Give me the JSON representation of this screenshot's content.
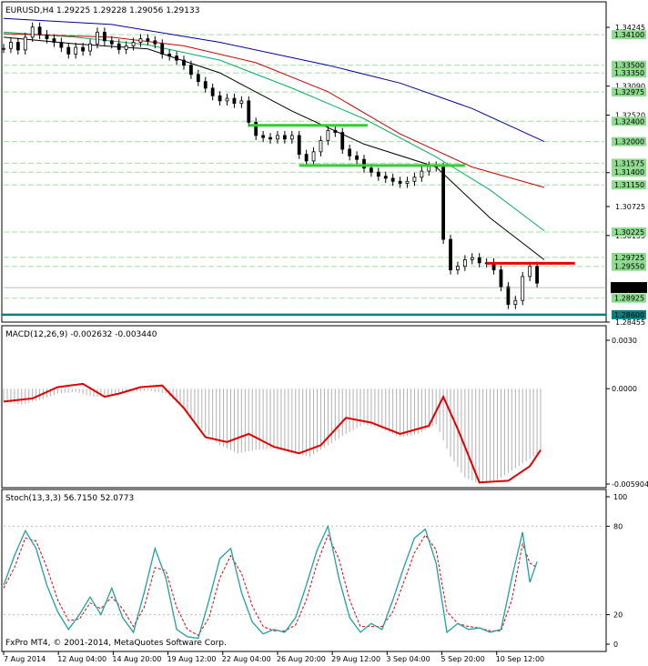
{
  "chart_data": [
    {
      "id": "price",
      "type": "candlestick",
      "title": "EURUSD,H4  1.29225 1.29228 1.29056 1.29133",
      "symbol": "EURUSD,H4",
      "ohlc_last": [
        1.29225,
        1.29228,
        1.29056,
        1.29133
      ],
      "ylim": [
        1.28455,
        1.34424
      ],
      "y_tick_labels": [
        "1.34245",
        "1.33090",
        "1.32520",
        "1.31390",
        "1.30725",
        "1.30155",
        "1.28455"
      ],
      "current_price": "1.29133",
      "level_labels": [
        "1.34100",
        "1.33500",
        "1.33350",
        "1.32975",
        "1.32400",
        "1.32000",
        "1.31575",
        "1.31400",
        "1.31150",
        "1.30225",
        "1.29725",
        "1.29550",
        "1.28925",
        "1.28600"
      ],
      "horizontal_levels": [
        1.341,
        1.335,
        1.3335,
        1.32975,
        1.324,
        1.32,
        1.31575,
        1.314,
        1.3115,
        1.30225,
        1.29725,
        1.2955,
        1.28925
      ],
      "support_level": 1.286,
      "green_lines": [
        {
          "x_from": 68,
          "x_to": 101,
          "y": 1.3232
        },
        {
          "x_from": 82,
          "x_to": 128,
          "y": 1.3153
        }
      ],
      "red_line": {
        "x_from": 134,
        "x_to": 157,
        "y": 1.2961
      },
      "bar_count": 150,
      "candles": [
        {
          "x": 0,
          "c": 1.3383
        },
        {
          "x": 2,
          "c": 1.3395
        },
        {
          "x": 4,
          "c": 1.338
        },
        {
          "x": 6,
          "c": 1.3405
        },
        {
          "x": 8,
          "c": 1.3425
        },
        {
          "x": 10,
          "c": 1.341
        },
        {
          "x": 12,
          "c": 1.3402
        },
        {
          "x": 14,
          "c": 1.3395
        },
        {
          "x": 16,
          "c": 1.3385
        },
        {
          "x": 18,
          "c": 1.3372
        },
        {
          "x": 20,
          "c": 1.3385
        },
        {
          "x": 22,
          "c": 1.3378
        },
        {
          "x": 24,
          "c": 1.3392
        },
        {
          "x": 26,
          "c": 1.3415
        },
        {
          "x": 28,
          "c": 1.3398
        },
        {
          "x": 30,
          "c": 1.3392
        },
        {
          "x": 32,
          "c": 1.3381
        },
        {
          "x": 34,
          "c": 1.3388
        },
        {
          "x": 36,
          "c": 1.3395
        },
        {
          "x": 38,
          "c": 1.3402
        },
        {
          "x": 40,
          "c": 1.3398
        },
        {
          "x": 42,
          "c": 1.3392
        },
        {
          "x": 44,
          "c": 1.3372
        },
        {
          "x": 46,
          "c": 1.3368
        },
        {
          "x": 48,
          "c": 1.336
        },
        {
          "x": 50,
          "c": 1.335
        },
        {
          "x": 52,
          "c": 1.3332
        },
        {
          "x": 54,
          "c": 1.3318
        },
        {
          "x": 56,
          "c": 1.3305
        },
        {
          "x": 58,
          "c": 1.329
        },
        {
          "x": 60,
          "c": 1.328
        },
        {
          "x": 62,
          "c": 1.3285
        },
        {
          "x": 64,
          "c": 1.3275
        },
        {
          "x": 66,
          "c": 1.328
        },
        {
          "x": 68,
          "c": 1.3238
        },
        {
          "x": 70,
          "c": 1.3212
        },
        {
          "x": 72,
          "c": 1.3208
        },
        {
          "x": 74,
          "c": 1.3205
        },
        {
          "x": 76,
          "c": 1.3212
        },
        {
          "x": 78,
          "c": 1.3205
        },
        {
          "x": 80,
          "c": 1.3212
        },
        {
          "x": 82,
          "c": 1.3175
        },
        {
          "x": 84,
          "c": 1.3162
        },
        {
          "x": 86,
          "c": 1.318
        },
        {
          "x": 88,
          "c": 1.3202
        },
        {
          "x": 90,
          "c": 1.3222
        },
        {
          "x": 92,
          "c": 1.3218
        },
        {
          "x": 94,
          "c": 1.3185
        },
        {
          "x": 96,
          "c": 1.3172
        },
        {
          "x": 98,
          "c": 1.3165
        },
        {
          "x": 100,
          "c": 1.3148
        },
        {
          "x": 102,
          "c": 1.314
        },
        {
          "x": 104,
          "c": 1.3132
        },
        {
          "x": 106,
          "c": 1.3128
        },
        {
          "x": 108,
          "c": 1.3122
        },
        {
          "x": 110,
          "c": 1.3118
        },
        {
          "x": 112,
          "c": 1.3122
        },
        {
          "x": 114,
          "c": 1.313
        },
        {
          "x": 116,
          "c": 1.3142
        },
        {
          "x": 118,
          "c": 1.3152
        },
        {
          "x": 120,
          "c": 1.315
        },
        {
          "x": 122,
          "c": 1.3008
        },
        {
          "x": 124,
          "c": 1.2948
        },
        {
          "x": 126,
          "c": 1.2955
        },
        {
          "x": 128,
          "c": 1.2968
        },
        {
          "x": 130,
          "c": 1.2972
        },
        {
          "x": 132,
          "c": 1.2962
        },
        {
          "x": 134,
          "c": 1.2962
        },
        {
          "x": 136,
          "c": 1.2948
        },
        {
          "x": 138,
          "c": 1.2915
        },
        {
          "x": 140,
          "c": 1.288
        },
        {
          "x": 142,
          "c": 1.2888
        },
        {
          "x": 144,
          "c": 1.2935
        },
        {
          "x": 146,
          "c": 1.2955
        },
        {
          "x": 148,
          "c": 1.2922
        }
      ],
      "moving_averages": [
        {
          "color": "#000000",
          "points": [
            [
              0,
              1.3405
            ],
            [
              20,
              1.3392
            ],
            [
              40,
              1.3382
            ],
            [
              60,
              1.3335
            ],
            [
              80,
              1.326
            ],
            [
              100,
              1.3195
            ],
            [
              120,
              1.315
            ],
            [
              135,
              1.305
            ],
            [
              150,
              1.2968
            ]
          ]
        },
        {
          "color": "#00b060",
          "points": [
            [
              0,
              1.3415
            ],
            [
              20,
              1.3405
            ],
            [
              40,
              1.339
            ],
            [
              60,
              1.336
            ],
            [
              80,
              1.3305
            ],
            [
              100,
              1.3245
            ],
            [
              120,
              1.317
            ],
            [
              135,
              1.3105
            ],
            [
              150,
              1.3025
            ]
          ]
        },
        {
          "color": "#cc0000",
          "points": [
            [
              0,
              1.3412
            ],
            [
              30,
              1.3405
            ],
            [
              50,
              1.3388
            ],
            [
              70,
              1.3355
            ],
            [
              90,
              1.3298
            ],
            [
              110,
              1.3215
            ],
            [
              130,
              1.315
            ],
            [
              150,
              1.311
            ]
          ]
        },
        {
          "color": "#000099",
          "points": [
            [
              0,
              1.3442
            ],
            [
              30,
              1.343
            ],
            [
              60,
              1.3395
            ],
            [
              90,
              1.335
            ],
            [
              110,
              1.3315
            ],
            [
              130,
              1.3265
            ],
            [
              150,
              1.32
            ]
          ]
        }
      ]
    },
    {
      "id": "macd",
      "type": "bar+line",
      "title": "MACD(12,26,9) -0.002632 -0.003440",
      "ylim": [
        -0.00590418,
        0.003
      ],
      "y_tick_labels": [
        "0.0030",
        "0.0000",
        "-0.005904"
      ],
      "histogram": [
        {
          "x": 0,
          "v": -0.0008
        },
        {
          "x": 5,
          "v": -0.001
        },
        {
          "x": 10,
          "v": -0.0007
        },
        {
          "x": 15,
          "v": -0.0003
        },
        {
          "x": 20,
          "v": -0.0002
        },
        {
          "x": 25,
          "v": -0.0005
        },
        {
          "x": 30,
          "v": -0.0004
        },
        {
          "x": 35,
          "v": -0.0002
        },
        {
          "x": 40,
          "v": -0.0001
        },
        {
          "x": 45,
          "v": -0.0003
        },
        {
          "x": 50,
          "v": -0.0012
        },
        {
          "x": 55,
          "v": -0.0025
        },
        {
          "x": 60,
          "v": -0.0035
        },
        {
          "x": 65,
          "v": -0.004
        },
        {
          "x": 70,
          "v": -0.0038
        },
        {
          "x": 75,
          "v": -0.0037
        },
        {
          "x": 80,
          "v": -0.004
        },
        {
          "x": 85,
          "v": -0.0042
        },
        {
          "x": 90,
          "v": -0.0035
        },
        {
          "x": 95,
          "v": -0.0028
        },
        {
          "x": 100,
          "v": -0.0022
        },
        {
          "x": 105,
          "v": -0.0025
        },
        {
          "x": 110,
          "v": -0.003
        },
        {
          "x": 115,
          "v": -0.0028
        },
        {
          "x": 120,
          "v": -0.0022
        },
        {
          "x": 124,
          "v": -0.0042
        },
        {
          "x": 128,
          "v": -0.0055
        },
        {
          "x": 132,
          "v": -0.0059
        },
        {
          "x": 136,
          "v": -0.0058
        },
        {
          "x": 140,
          "v": -0.0052
        },
        {
          "x": 145,
          "v": -0.0045
        },
        {
          "x": 149,
          "v": -0.0039
        }
      ],
      "signal": [
        [
          0,
          -0.0008
        ],
        [
          8,
          -0.0006
        ],
        [
          15,
          0.0001
        ],
        [
          22,
          0.0003
        ],
        [
          28,
          -0.0005
        ],
        [
          32,
          -0.0003
        ],
        [
          38,
          0.0001
        ],
        [
          44,
          0.0002
        ],
        [
          50,
          -0.0012
        ],
        [
          56,
          -0.003
        ],
        [
          62,
          -0.0033
        ],
        [
          68,
          -0.0028
        ],
        [
          75,
          -0.0036
        ],
        [
          82,
          -0.004
        ],
        [
          88,
          -0.0035
        ],
        [
          95,
          -0.0018
        ],
        [
          102,
          -0.0021
        ],
        [
          110,
          -0.0028
        ],
        [
          118,
          -0.0023
        ],
        [
          122,
          -0.0005
        ],
        [
          126,
          -0.0025
        ],
        [
          132,
          -0.0058
        ],
        [
          140,
          -0.0057
        ],
        [
          146,
          -0.0048
        ],
        [
          149,
          -0.0038
        ]
      ]
    },
    {
      "id": "stoch",
      "type": "line",
      "title": "Stoch(13,3,3) 56.7150 52.0773",
      "ylim": [
        0,
        100
      ],
      "y_tick_labels": [
        "100",
        "80",
        "20",
        "0"
      ],
      "main": [
        [
          0,
          40
        ],
        [
          3,
          60
        ],
        [
          6,
          77
        ],
        [
          9,
          65
        ],
        [
          12,
          40
        ],
        [
          15,
          22
        ],
        [
          18,
          10
        ],
        [
          21,
          20
        ],
        [
          24,
          32
        ],
        [
          27,
          20
        ],
        [
          30,
          38
        ],
        [
          33,
          18
        ],
        [
          36,
          8
        ],
        [
          39,
          35
        ],
        [
          42,
          65
        ],
        [
          45,
          45
        ],
        [
          48,
          10
        ],
        [
          51,
          5
        ],
        [
          54,
          4
        ],
        [
          57,
          30
        ],
        [
          60,
          58
        ],
        [
          63,
          65
        ],
        [
          66,
          35
        ],
        [
          69,
          15
        ],
        [
          72,
          7
        ],
        [
          75,
          10
        ],
        [
          78,
          8
        ],
        [
          81,
          18
        ],
        [
          84,
          40
        ],
        [
          87,
          64
        ],
        [
          90,
          80
        ],
        [
          93,
          45
        ],
        [
          96,
          18
        ],
        [
          99,
          8
        ],
        [
          102,
          14
        ],
        [
          105,
          10
        ],
        [
          108,
          30
        ],
        [
          111,
          52
        ],
        [
          114,
          72
        ],
        [
          117,
          78
        ],
        [
          120,
          55
        ],
        [
          123,
          8
        ],
        [
          126,
          14
        ],
        [
          129,
          10
        ],
        [
          132,
          11
        ],
        [
          135,
          8
        ],
        [
          138,
          10
        ],
        [
          141,
          45
        ],
        [
          144,
          76
        ],
        [
          146,
          42
        ],
        [
          148,
          56
        ]
      ],
      "signal": [
        [
          0,
          38
        ],
        [
          3,
          52
        ],
        [
          6,
          72
        ],
        [
          9,
          70
        ],
        [
          12,
          52
        ],
        [
          15,
          30
        ],
        [
          18,
          16
        ],
        [
          21,
          17
        ],
        [
          24,
          28
        ],
        [
          27,
          24
        ],
        [
          30,
          32
        ],
        [
          33,
          24
        ],
        [
          36,
          12
        ],
        [
          39,
          25
        ],
        [
          42,
          52
        ],
        [
          45,
          50
        ],
        [
          48,
          25
        ],
        [
          51,
          10
        ],
        [
          54,
          6
        ],
        [
          57,
          18
        ],
        [
          60,
          45
        ],
        [
          63,
          60
        ],
        [
          66,
          48
        ],
        [
          69,
          26
        ],
        [
          72,
          12
        ],
        [
          75,
          9
        ],
        [
          78,
          9
        ],
        [
          81,
          13
        ],
        [
          84,
          30
        ],
        [
          87,
          55
        ],
        [
          90,
          74
        ],
        [
          93,
          58
        ],
        [
          96,
          30
        ],
        [
          99,
          12
        ],
        [
          102,
          12
        ],
        [
          105,
          12
        ],
        [
          108,
          22
        ],
        [
          111,
          42
        ],
        [
          114,
          62
        ],
        [
          117,
          74
        ],
        [
          120,
          64
        ],
        [
          123,
          22
        ],
        [
          126,
          14
        ],
        [
          129,
          12
        ],
        [
          132,
          11
        ],
        [
          135,
          9
        ],
        [
          138,
          9
        ],
        [
          141,
          30
        ],
        [
          144,
          68
        ],
        [
          146,
          55
        ],
        [
          148,
          52
        ]
      ]
    }
  ],
  "x_axis_labels": [
    "7 Aug 2014",
    "12 Aug 04:00",
    "14 Aug 20:00",
    "19 Aug 12:00",
    "22 Aug 04:00",
    "26 Aug 20:00",
    "29 Aug 12:00",
    "3 Sep 04:00",
    "5 Sep 20:00",
    "10 Sep 12:00"
  ],
  "footer": "FxPro MT4,  © 2001-2014, MetaQuotes Software Corp.",
  "colors": {
    "up": "#000000",
    "level": "#9fdf9f",
    "label_bg": "#8fdb8f",
    "support": "#008080",
    "macd_hist": "#b0b0b0",
    "macd_signal": "#e00000",
    "stoch_main": "#20a0a0",
    "stoch_signal": "#e00000"
  }
}
